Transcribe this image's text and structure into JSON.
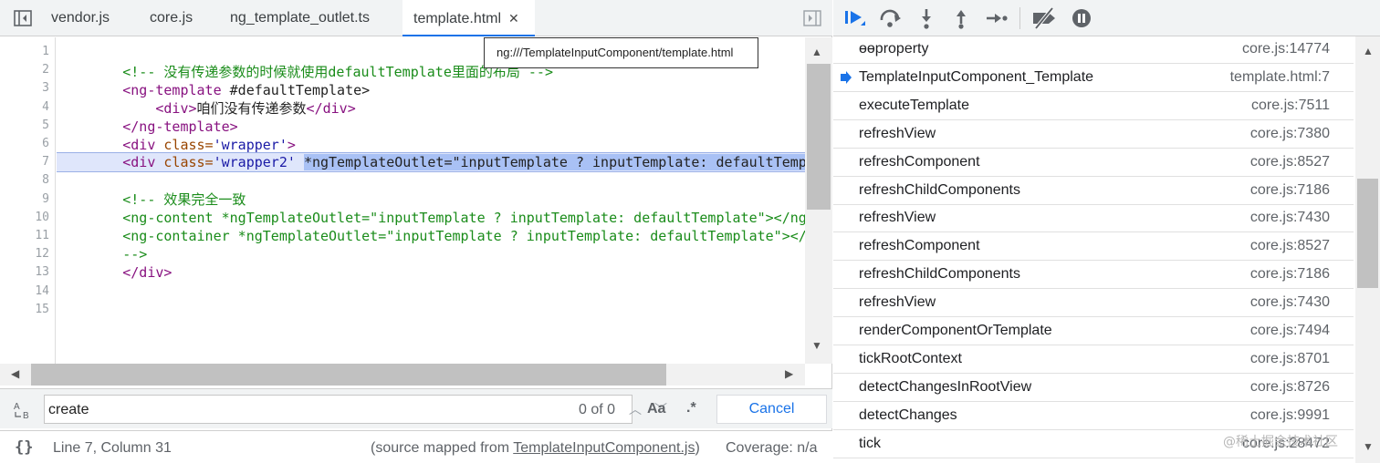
{
  "tabs": [
    {
      "label": "vendor.js"
    },
    {
      "label": "core.js"
    },
    {
      "label": "ng_template_outlet.ts"
    },
    {
      "label": "template.html"
    }
  ],
  "tooltip": "ng:///TemplateInputComponent/template.html",
  "code": {
    "line_numbers": [
      "1",
      "2",
      "3",
      "4",
      "5",
      "6",
      "7",
      "8",
      "9",
      "10",
      "11",
      "12",
      "13",
      "14",
      "15"
    ],
    "l2_comment": "<!-- 没有传递参数的时候就使用defaultTemplate里面的布局 -->",
    "l3_tag": "<ng-template",
    "l3_rest": " #defaultTemplate>",
    "l4_open": "<div>",
    "l4_text": "咱们没有传递参数",
    "l4_close": "</div>",
    "l5_tag": "</ng-template>",
    "l6_tag": "<div",
    "l6_attr": " class=",
    "l6_val": "'wrapper'",
    "l6_end": ">",
    "l7_tag": "<div",
    "l7_attr": " class=",
    "l7_val": "'wrapper2'",
    "l7_sel": "*ngTemplateOutlet=\"inputTemplate ? inputTemplate: defaultTemplate\"></div>",
    "l9_comment": "<!-- 效果完全一致",
    "l10": "<ng-content *ngTemplateOutlet=\"inputTemplate ? inputTemplate: defaultTemplate\"></ng-content>",
    "l11": "<ng-container *ngTemplateOutlet=\"inputTemplate ? inputTemplate: defaultTemplate\"></ng-container>",
    "l12": "-->",
    "l13": "</div>"
  },
  "search": {
    "value": "create",
    "match_count": "0 of 0",
    "match_case": "Aa",
    "regex": ".*",
    "cancel": "Cancel"
  },
  "status": {
    "position": "Line 7, Column 31",
    "source_prefix": "(source mapped from ",
    "source_link": "TemplateInputComponent.js",
    "source_suffix": ")",
    "coverage": "Coverage: n/a"
  },
  "call_stack": [
    {
      "name": "ɵɵproperty",
      "location": "core.js:14774"
    },
    {
      "name": "TemplateInputComponent_Template",
      "location": "template.html:7"
    },
    {
      "name": "executeTemplate",
      "location": "core.js:7511"
    },
    {
      "name": "refreshView",
      "location": "core.js:7380"
    },
    {
      "name": "refreshComponent",
      "location": "core.js:8527"
    },
    {
      "name": "refreshChildComponents",
      "location": "core.js:7186"
    },
    {
      "name": "refreshView",
      "location": "core.js:7430"
    },
    {
      "name": "refreshComponent",
      "location": "core.js:8527"
    },
    {
      "name": "refreshChildComponents",
      "location": "core.js:7186"
    },
    {
      "name": "refreshView",
      "location": "core.js:7430"
    },
    {
      "name": "renderComponentOrTemplate",
      "location": "core.js:7494"
    },
    {
      "name": "tickRootContext",
      "location": "core.js:8701"
    },
    {
      "name": "detectChangesInRootView",
      "location": "core.js:8726"
    },
    {
      "name": "detectChanges",
      "location": "core.js:9991"
    },
    {
      "name": "tick",
      "location": "core.js:28472"
    }
  ],
  "watermark": "@稀土掘金技术社区",
  "colors": {
    "accent": "#1a73e8",
    "selection": "#a9c1f5"
  }
}
